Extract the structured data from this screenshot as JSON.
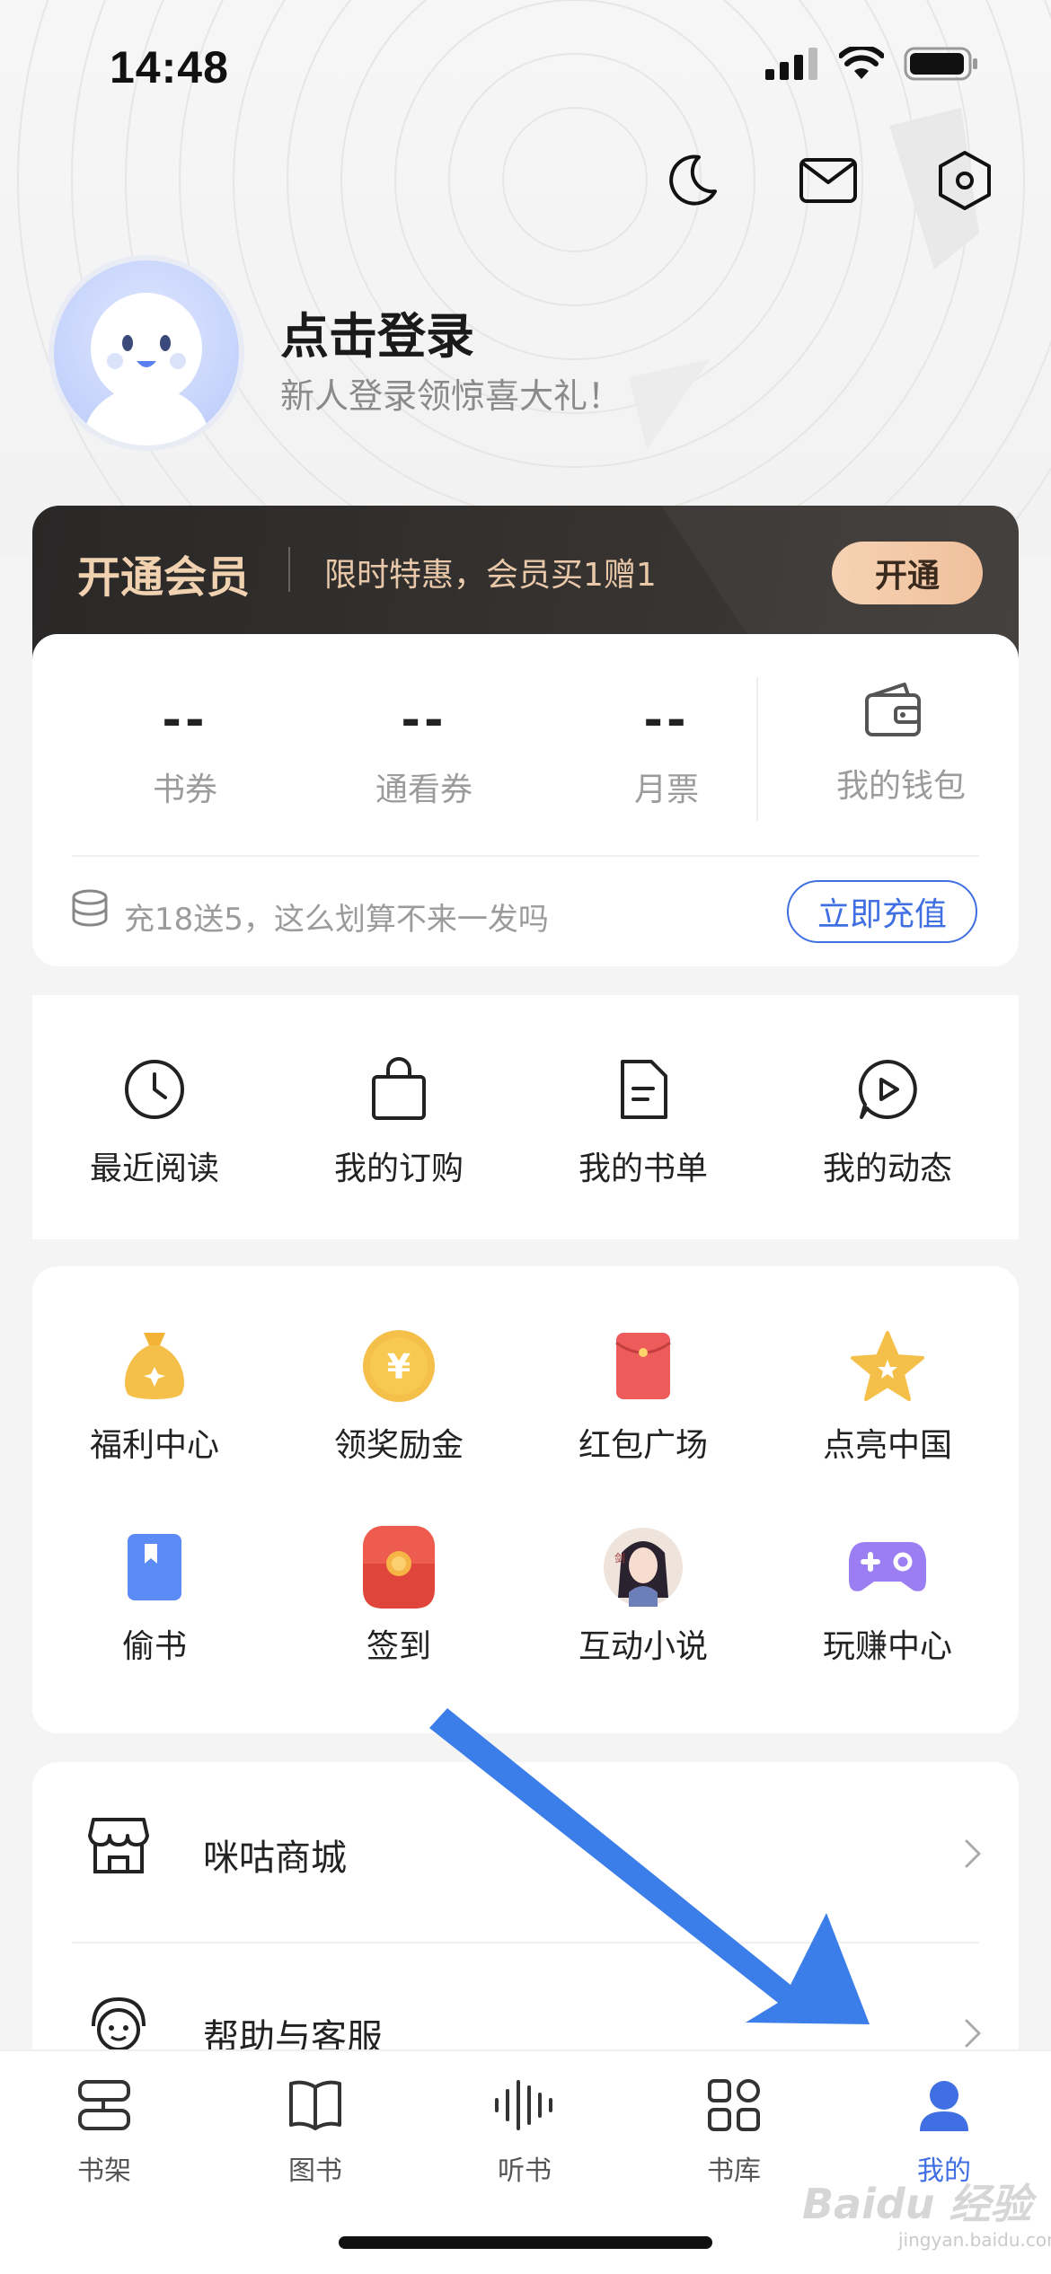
{
  "status_bar": {
    "time": "14:48"
  },
  "profile": {
    "login_title": "点击登录",
    "login_subtitle": "新人登录领惊喜大礼！"
  },
  "vip": {
    "title": "开通会员",
    "promo": "限时特惠，会员买1赠1",
    "button": "开通"
  },
  "wallet": {
    "stats": [
      {
        "value": "--",
        "label": "书券"
      },
      {
        "value": "--",
        "label": "通看券"
      },
      {
        "value": "--",
        "label": "月票"
      }
    ],
    "wallet_label": "我的钱包",
    "recharge_text": "充18送5，这么划算不来一发吗",
    "recharge_button": "立即充值"
  },
  "quick_actions": [
    {
      "label": "最近阅读",
      "icon": "clock-icon"
    },
    {
      "label": "我的订购",
      "icon": "shopping-bag-icon"
    },
    {
      "label": "我的书单",
      "icon": "document-icon"
    },
    {
      "label": "我的动态",
      "icon": "play-bubble-icon"
    }
  ],
  "features": [
    {
      "label": "福利中心",
      "icon": "money-bag-icon"
    },
    {
      "label": "领奖励金",
      "icon": "yuan-coin-icon"
    },
    {
      "label": "红包广场",
      "icon": "red-envelope-icon"
    },
    {
      "label": "点亮中国",
      "icon": "star-icon"
    },
    {
      "label": "偷书",
      "icon": "book-bookmark-icon"
    },
    {
      "label": "签到",
      "icon": "sign-in-envelope-icon"
    },
    {
      "label": "互动小说",
      "icon": "story-avatar-icon"
    },
    {
      "label": "玩赚中心",
      "icon": "gamepad-icon"
    }
  ],
  "list_items": [
    {
      "label": "咪咕商城",
      "icon": "store-icon"
    },
    {
      "label": "帮助与客服",
      "icon": "customer-service-icon"
    }
  ],
  "tabbar": [
    {
      "label": "书架",
      "icon": "bookshelf-icon",
      "active": false
    },
    {
      "label": "图书",
      "icon": "open-book-icon",
      "active": false
    },
    {
      "label": "听书",
      "icon": "audio-wave-icon",
      "active": false
    },
    {
      "label": "书库",
      "icon": "grid-icon",
      "active": false
    },
    {
      "label": "我的",
      "icon": "user-icon",
      "active": true
    }
  ],
  "colors": {
    "accent": "#3f6fe2",
    "vip_gold": "#f0d2b0",
    "arrow": "#3b7de9"
  },
  "watermark": {
    "text": "Baidu 经验",
    "sub": "jingyan.baidu.com"
  }
}
